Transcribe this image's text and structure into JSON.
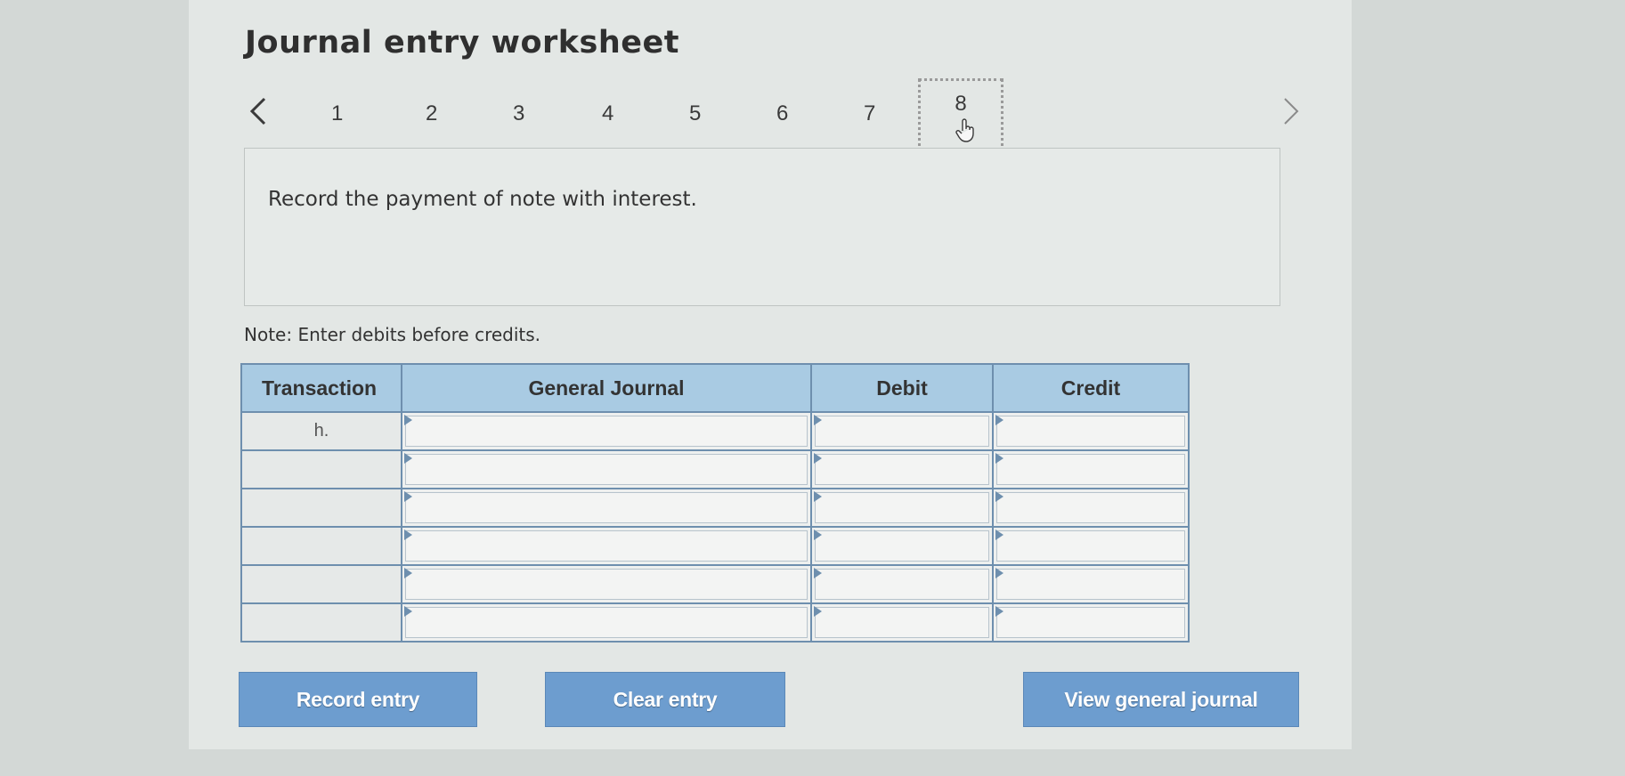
{
  "title": "Journal entry worksheet",
  "pager": {
    "pages": [
      "1",
      "2",
      "3",
      "4",
      "5",
      "6",
      "7"
    ],
    "current": "8",
    "prev_icon": "chevron-left-icon",
    "next_icon": "chevron-right-icon",
    "cursor_icon": "hand-pointer-icon"
  },
  "instruction": "Record the payment of note with interest.",
  "note": "Note: Enter debits before credits.",
  "table": {
    "headers": [
      "Transaction",
      "General Journal",
      "Debit",
      "Credit"
    ],
    "rows": [
      {
        "transaction": "h."
      },
      {
        "transaction": ""
      },
      {
        "transaction": ""
      },
      {
        "transaction": ""
      },
      {
        "transaction": ""
      },
      {
        "transaction": ""
      }
    ]
  },
  "buttons": {
    "record": "Record entry",
    "clear": "Clear entry",
    "view": "View general journal"
  },
  "colors": {
    "header_bg": "#a9cbe3",
    "button_bg": "#6d9dcf",
    "border": "#6e8fae"
  }
}
